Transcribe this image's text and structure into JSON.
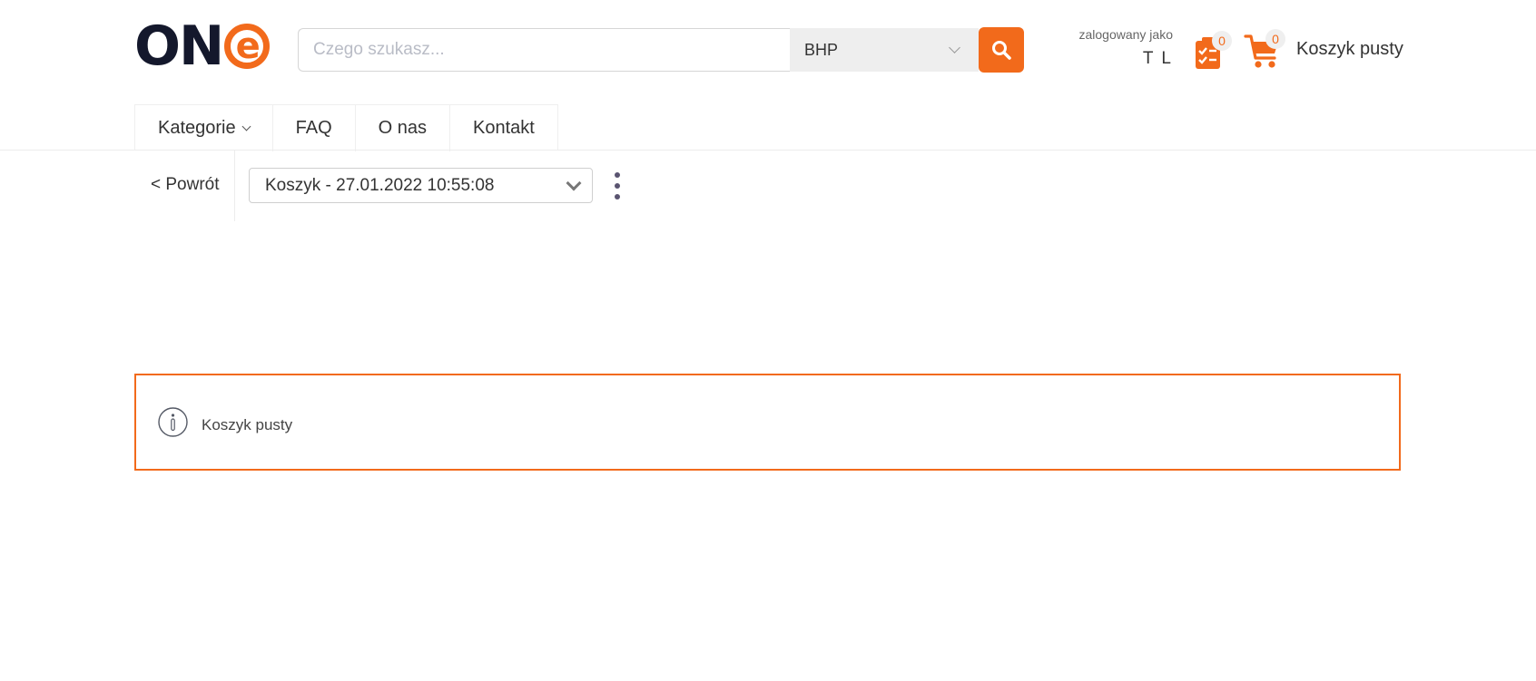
{
  "brand": {
    "logo_text": "ON",
    "logo_accent": "e",
    "accent_color": "#f26a1b",
    "dark_color": "#14182c"
  },
  "search": {
    "placeholder": "Czego szukasz...",
    "value": "",
    "category": "BHP",
    "button_icon": "search-icon"
  },
  "user": {
    "prefix": "zalogowany jako",
    "name": "T L"
  },
  "shopping_list": {
    "icon": "clipboard-list-icon",
    "count": "0"
  },
  "cart": {
    "icon": "cart-icon",
    "count": "0",
    "label": "Koszyk pusty"
  },
  "nav": {
    "items": [
      {
        "label": "Kategorie",
        "has_dropdown": true
      },
      {
        "label": "FAQ"
      },
      {
        "label": "O nas"
      },
      {
        "label": "Kontakt"
      }
    ]
  },
  "toolbar": {
    "back_label": "< Powrót",
    "cart_selector_value": "Koszyk - 27.01.2022 10:55:08",
    "more_icon": "kebab-menu-icon"
  },
  "message": {
    "icon": "info-icon",
    "text": "Koszyk pusty"
  }
}
